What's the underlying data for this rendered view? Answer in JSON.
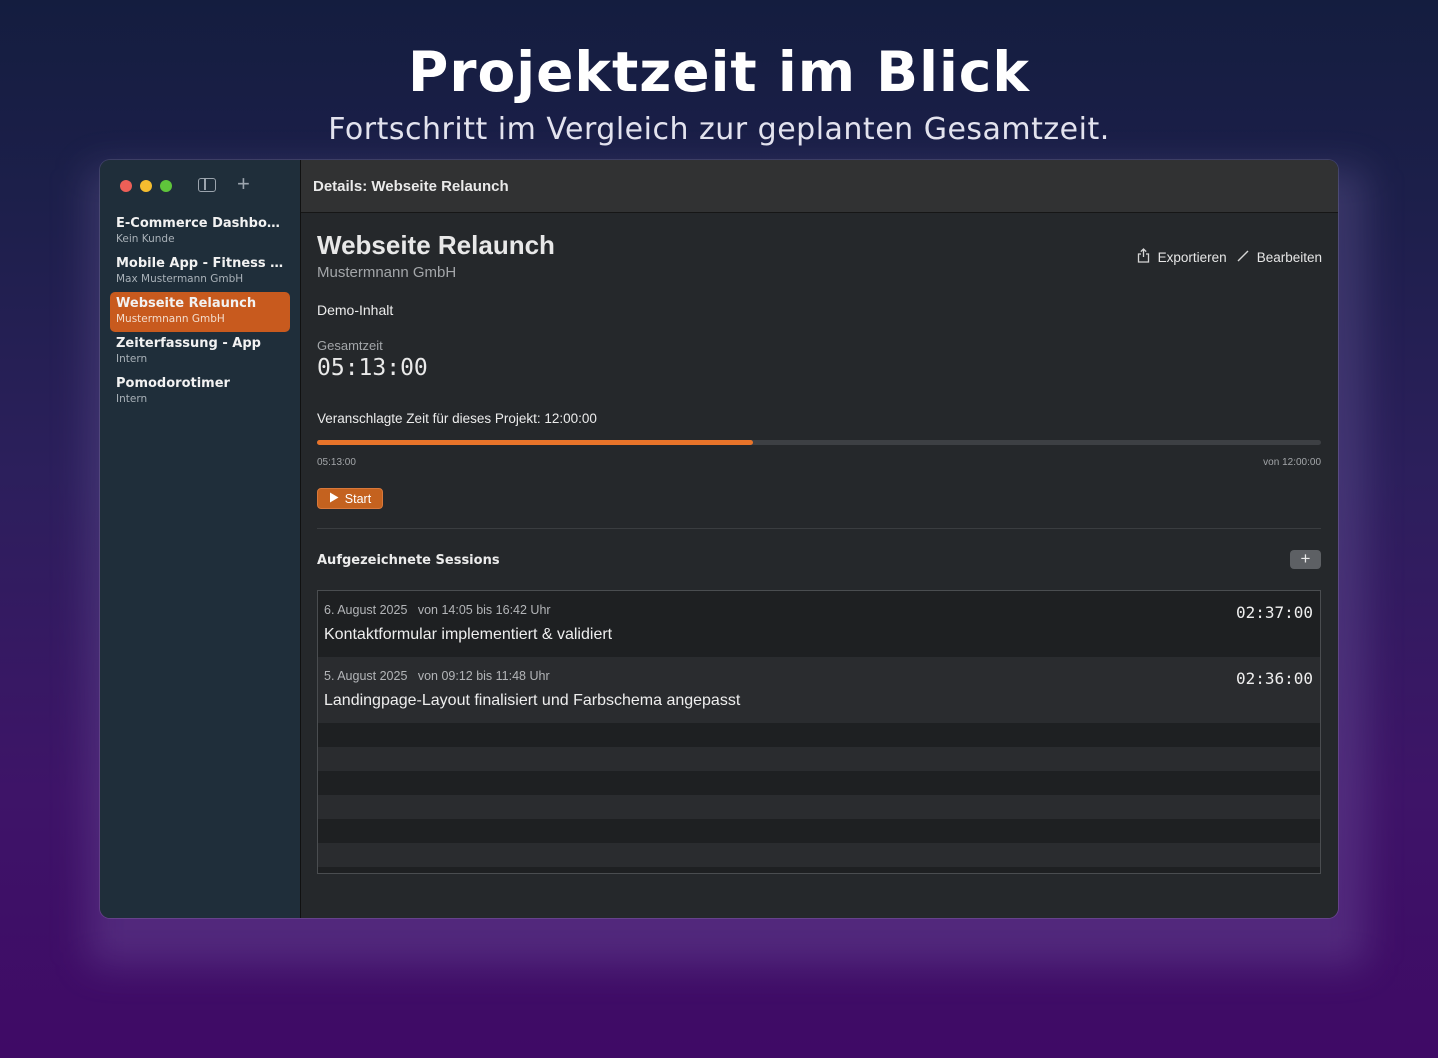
{
  "hero": {
    "title": "Projektzeit im Blick",
    "subtitle": "Fortschritt im Vergleich zur geplanten Gesamtzeit."
  },
  "window": {
    "title": "Details: Webseite Relaunch"
  },
  "sidebar": {
    "projects": [
      {
        "name": "E-Commerce Dashboard",
        "client": "Kein Kunde",
        "selected": false
      },
      {
        "name": "Mobile App - Fitness Tr...",
        "client": "Max Mustermann GmbH",
        "selected": false
      },
      {
        "name": "Webseite Relaunch",
        "client": "Mustermnann GmbH",
        "selected": true
      },
      {
        "name": "Zeiterfassung - App",
        "client": "Intern",
        "selected": false
      },
      {
        "name": "Pomodorotimer",
        "client": "Intern",
        "selected": false
      }
    ]
  },
  "detail": {
    "project_title": "Webseite Relaunch",
    "client": "Mustermnann GmbH",
    "export_label": "Exportieren",
    "edit_label": "Bearbeiten",
    "note": "Demo-Inhalt",
    "total_label": "Gesamtzeit",
    "total_value": "05:13:00",
    "budget_text": "Veranschlagte Zeit für dieses Projekt: 12:00:00",
    "progress_left": "05:13:00",
    "progress_right": "von 12:00:00",
    "progress_fraction": 0.4347,
    "start_label": "Start",
    "sessions_heading": "Aufgezeichnete Sessions",
    "add_label": "+"
  },
  "sessions": [
    {
      "date": "6. August 2025",
      "time": "von 14:05 bis 16:42 Uhr",
      "description": "Kontaktformular implementiert & validiert",
      "duration": "02:37:00"
    },
    {
      "date": "5. August 2025",
      "time": "von 09:12 bis 11:48 Uhr",
      "description": "Landingpage-Layout finalisiert und Farbschema angepasst",
      "duration": "02:36:00"
    }
  ],
  "colors": {
    "accent": "#c85a1e",
    "progress": "#e8742a",
    "sidebar_bg": "#1f2e3a",
    "content_bg": "#25282b"
  }
}
